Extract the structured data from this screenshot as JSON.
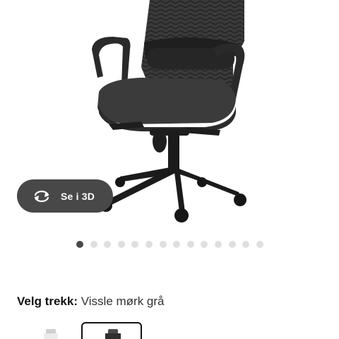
{
  "product": {
    "image_alt": "Office chair with black mesh back",
    "view_3d_label": "Se i 3D",
    "view_3d_icon": "rotate-3d-icon"
  },
  "carousel": {
    "total_dots": 14,
    "active_index": 0
  },
  "cover": {
    "label": "Velg trekk:",
    "value": "Vissle mørk grå"
  },
  "swatches": [
    {
      "name": "light-grey",
      "color": "#e8e8e8",
      "selected": false
    },
    {
      "name": "dark-grey",
      "color": "#333333",
      "selected": true
    }
  ],
  "colors": {
    "button_bg": "#484848",
    "dot_active": "#484848",
    "dot_inactive": "#dfdfdf"
  }
}
